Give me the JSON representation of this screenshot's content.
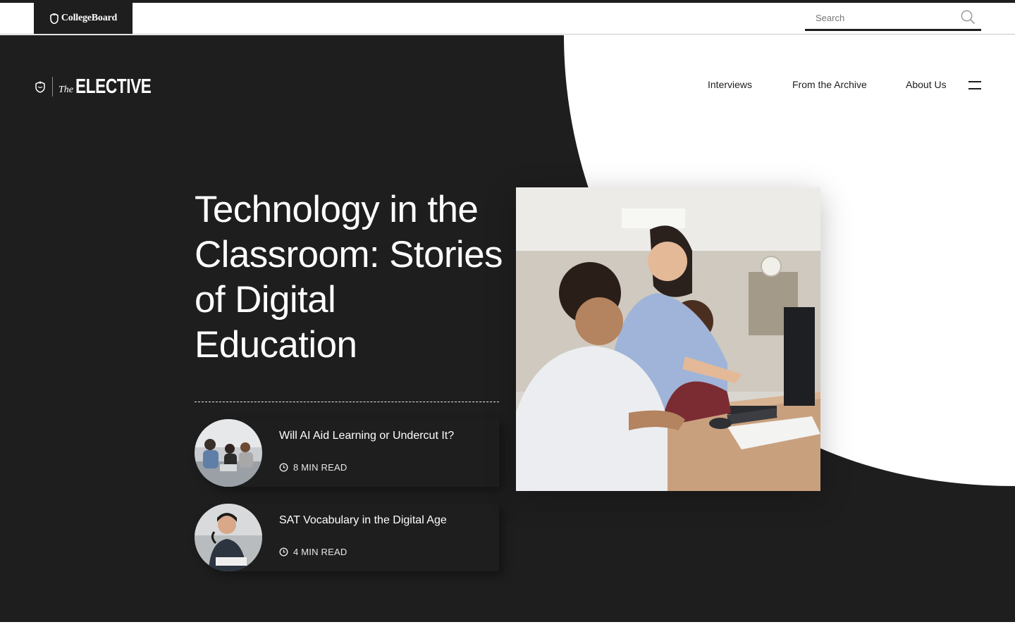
{
  "global_header": {
    "logo_text": "CollegeBoard",
    "search": {
      "placeholder": "Search",
      "value": ""
    }
  },
  "site_brand": {
    "the": "The",
    "name": "ELECTIVE"
  },
  "nav": {
    "items": [
      {
        "label": "Interviews"
      },
      {
        "label": "From the Archive"
      },
      {
        "label": "About Us"
      }
    ],
    "menu_icon": "hamburger-menu-icon"
  },
  "hero": {
    "headline": "Technology in the Classroom: Stories of Digital Education",
    "articles": [
      {
        "title": "Will AI Aid Learning or Undercut It?",
        "read_time": "8 MIN READ",
        "icon": "clock-icon"
      },
      {
        "title": "SAT Vocabulary in the Digital Age",
        "read_time": "4 MIN READ",
        "icon": "clock-icon"
      }
    ]
  },
  "colors": {
    "dark": "#1e1e1e",
    "light": "#ffffff"
  }
}
